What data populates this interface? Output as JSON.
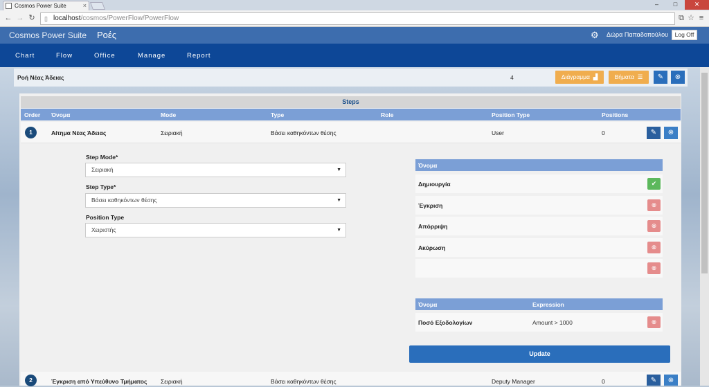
{
  "browser": {
    "tab_title": "Cosmos Power Suite",
    "url_host": "localhost",
    "url_path": "/cosmos/PowerFlow/PowerFlow"
  },
  "header": {
    "brand": "Cosmos Power Suite",
    "section": "Ροές",
    "user_name": "Δώρα Παπαδοπούλου",
    "logoff": "Log Off"
  },
  "nav": [
    "Chart",
    "Flow",
    "Office",
    "Manage",
    "Report"
  ],
  "flow": {
    "title": "Ροή Νέας Άδειας",
    "count": "4",
    "diagram_label": "Διάγραμμα",
    "steps_label": "Βήματα"
  },
  "steps_table": {
    "title": "Steps",
    "columns": [
      "Order",
      "Όνομα",
      "Mode",
      "Type",
      "Role",
      "Position Type",
      "Positions"
    ],
    "rows": [
      {
        "order": "1",
        "name": "Αίτημα Νέας Άδειας",
        "mode": "Σειριακή",
        "type": "Βάσει καθηκόντων θέσης",
        "role": "",
        "position_type": "User",
        "positions": "0"
      },
      {
        "order": "2",
        "name": "Έγκριση από Υπεύθυνο Τμήματος",
        "mode": "Σειριακή",
        "type": "Βάσει καθηκόντων θέσης",
        "role": "",
        "position_type": "Deputy Manager",
        "positions": "0"
      }
    ]
  },
  "form": {
    "step_mode_label": "Step Mode*",
    "step_mode_value": "Σειριακή",
    "step_type_label": "Step Type*",
    "step_type_value": "Βάσει καθηκόντων θέσης",
    "position_type_label": "Position Type",
    "position_type_value": "Χειριστής"
  },
  "actions_table": {
    "header": "Όνομα",
    "rows": [
      "Δημιουργία",
      "Έγκριση",
      "Απόρριψη",
      "Ακύρωση",
      ""
    ]
  },
  "conditions_table": {
    "header_name": "Όνομα",
    "header_expression": "Expression",
    "rows": [
      {
        "name": "Ποσό Εξοδολογίων",
        "expression": "Amount > 1000"
      }
    ]
  },
  "update_label": "Update",
  "colors": {
    "header": "#3d6dae",
    "nav": "#0d4797",
    "table_head": "#7b9fd6",
    "accent": "#2a6ebb",
    "orange": "#f0ad4e",
    "green": "#5cb85c",
    "red": "#e58c8c"
  }
}
